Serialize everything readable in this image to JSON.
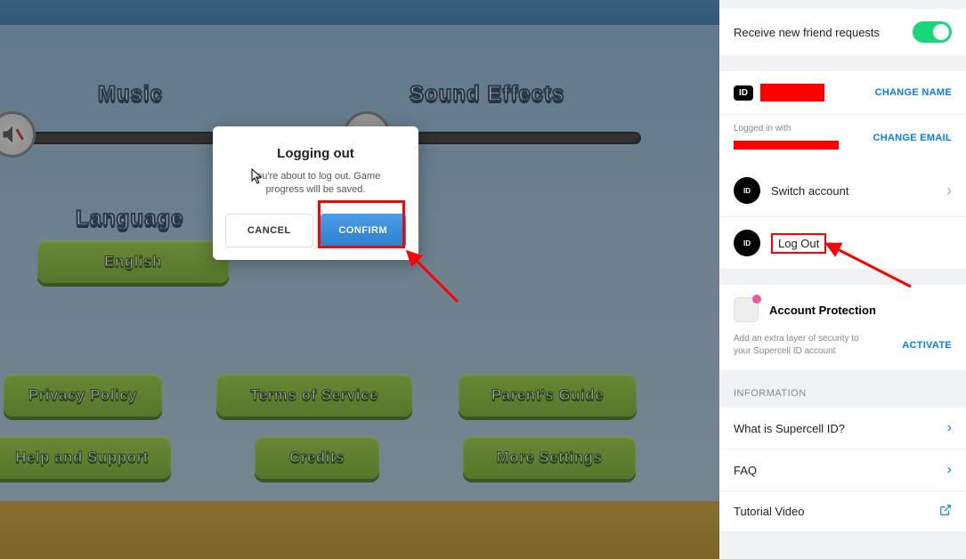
{
  "game": {
    "music_label": "Music",
    "sfx_label": "Sound Effects",
    "language_label": "Language",
    "language_value": "English",
    "buttons": {
      "privacy": "Privacy Policy",
      "terms": "Terms of Service",
      "parents": "Parent's Guide",
      "help": "Help and Support",
      "credits": "Credits",
      "more": "More Settings"
    }
  },
  "modal": {
    "title": "Logging out",
    "body": "You're about to log out. Game progress will be saved.",
    "cancel": "CANCEL",
    "confirm": "CONFIRM"
  },
  "sidebar": {
    "friend_requests": "Receive new friend requests",
    "id_badge": "ID",
    "change_name": "CHANGE NAME",
    "logged_in_label": "Logged in with",
    "change_email": "CHANGE EMAIL",
    "switch_account": "Switch account",
    "logout": "Log Out",
    "protection_title": "Account Protection",
    "protection_text": "Add an extra layer of security to your Supercell ID account",
    "activate": "ACTIVATE",
    "info_header": "INFORMATION",
    "what_is": "What is Supercell ID?",
    "faq": "FAQ",
    "tutorial": "Tutorial Video"
  },
  "colors": {
    "accent_blue": "#0a7de8",
    "game_green": "#7cb82f",
    "red": "#ff0000",
    "toggle_green": "#18d67a"
  }
}
